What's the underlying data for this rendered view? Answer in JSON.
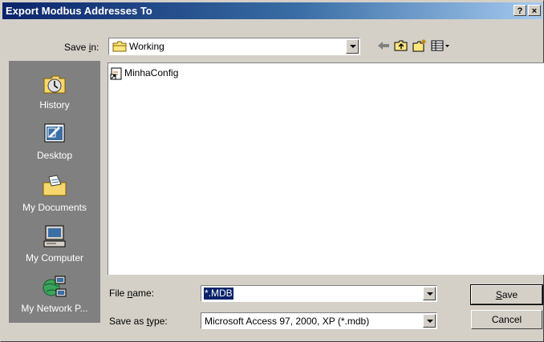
{
  "window": {
    "title": "Export Modbus Addresses To",
    "help_label": "?",
    "close_label": "×"
  },
  "save_in": {
    "label_pre": "Save ",
    "label_key": "i",
    "label_post": "n:",
    "value": "Working"
  },
  "toolbar": {
    "back_icon": "back-arrow-icon",
    "up_icon": "up-one-level-icon",
    "new_folder_icon": "create-new-folder-icon",
    "views_icon": "views-menu-icon"
  },
  "places": [
    {
      "label": "History",
      "icon": "history-icon"
    },
    {
      "label": "Desktop",
      "icon": "desktop-icon"
    },
    {
      "label": "My Documents",
      "icon": "my-documents-icon"
    },
    {
      "label": "My Computer",
      "icon": "my-computer-icon"
    },
    {
      "label": "My Network P...",
      "icon": "my-network-places-icon"
    }
  ],
  "files": [
    {
      "name": "MinhaConfig",
      "icon": "shortcut-file-icon"
    }
  ],
  "file_name": {
    "label_pre": "File ",
    "label_key": "n",
    "label_post": "ame:",
    "value": "*.MDB"
  },
  "save_as_type": {
    "label_pre": "Save as ",
    "label_key": "t",
    "label_post": "ype:",
    "value": "Microsoft Access 97, 2000, XP (*.mdb)"
  },
  "buttons": {
    "save_key": "S",
    "save_rest": "ave",
    "cancel": "Cancel"
  }
}
